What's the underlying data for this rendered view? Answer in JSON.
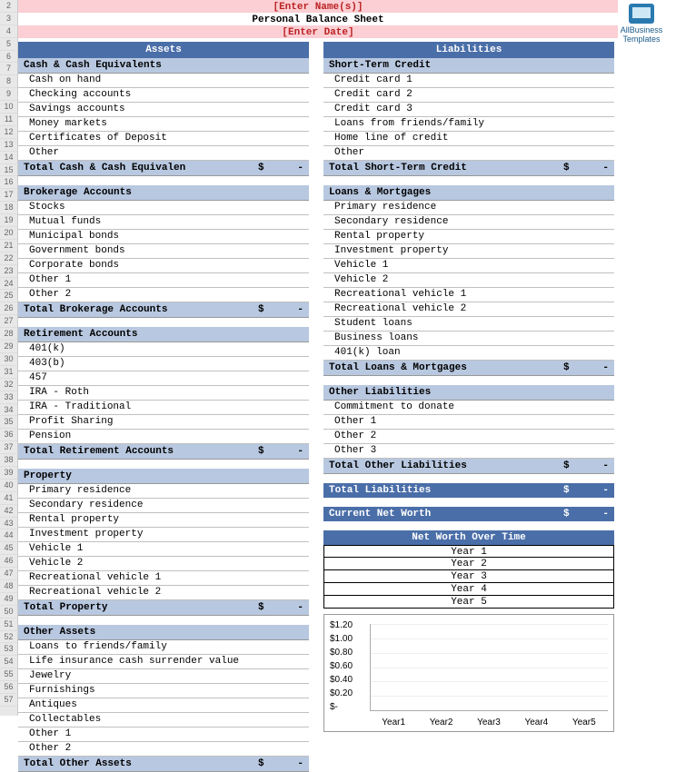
{
  "header": {
    "names_placeholder": "[Enter Name(s)]",
    "title": "Personal Balance Sheet",
    "date_placeholder": "[Enter Date]"
  },
  "logo": {
    "line1": "AllBusiness",
    "line2": "Templates"
  },
  "row_numbers": [
    2,
    3,
    4,
    5,
    6,
    7,
    8,
    9,
    10,
    11,
    12,
    13,
    14,
    15,
    16,
    17,
    18,
    19,
    20,
    21,
    22,
    23,
    24,
    25,
    26,
    27,
    28,
    29,
    30,
    31,
    32,
    33,
    34,
    35,
    36,
    37,
    38,
    39,
    40,
    41,
    42,
    43,
    44,
    45,
    46,
    47,
    48,
    49,
    50,
    51,
    52,
    53,
    54,
    55,
    56,
    57
  ],
  "assets": {
    "title": "Assets",
    "groups": [
      {
        "name": "Cash & Cash Equivalents",
        "items": [
          "Cash on hand",
          "Checking accounts",
          "Savings accounts",
          "Money markets",
          "Certificates of Deposit",
          "Other"
        ],
        "total": "Total Cash & Cash Equivalen"
      },
      {
        "name": "Brokerage Accounts",
        "items": [
          "Stocks",
          "Mutual funds",
          "Municipal bonds",
          "Government bonds",
          "Corporate bonds",
          "Other 1",
          "Other 2"
        ],
        "total": "Total Brokerage Accounts"
      },
      {
        "name": "Retirement Accounts",
        "items": [
          "401(k)",
          "403(b)",
          "457",
          "IRA - Roth",
          "IRA - Traditional",
          "Profit Sharing",
          "Pension"
        ],
        "total": "Total Retirement Accounts"
      },
      {
        "name": "Property",
        "items": [
          "Primary  residence",
          "Secondary residence",
          "Rental property",
          "Investment property",
          "Vehicle 1",
          "Vehicle 2",
          "Recreational vehicle 1",
          "Recreational vehicle 2"
        ],
        "total": "Total Property"
      },
      {
        "name": "Other Assets",
        "items": [
          "Loans to friends/family",
          "Life insurance cash surrender value",
          "Jewelry",
          "Furnishings",
          "Antiques",
          "Collectables",
          "Other 1",
          "Other 2"
        ],
        "total": "Total Other Assets"
      }
    ]
  },
  "liabilities": {
    "title": "Liabilities",
    "groups": [
      {
        "name": "Short-Term Credit",
        "items": [
          "Credit card 1",
          "Credit card 2",
          "Credit card 3",
          "Loans from friends/family",
          "Home line of credit",
          "Other"
        ],
        "total": "Total Short-Term Credit"
      },
      {
        "name": "Loans & Mortgages",
        "items": [
          "Primary  residence",
          "Secondary residence",
          "Rental property",
          "Investment property",
          "Vehicle 1",
          "Vehicle 2",
          "Recreational vehicle 1",
          "Recreational vehicle 2",
          "Student loans",
          "Business loans",
          "401(k) loan"
        ],
        "total": "Total Loans & Mortgages"
      },
      {
        "name": "Other Liabilities",
        "items": [
          "Commitment to donate",
          "Other 1",
          "Other 2",
          "Other 3"
        ],
        "total": "Total Other Liabilities"
      }
    ],
    "grand_total": "Total Liabilities"
  },
  "networth": {
    "current_label": "Current Net Worth",
    "overtime_title": "Net Worth Over Time",
    "years": [
      "Year 1",
      "Year 2",
      "Year 3",
      "Year 4",
      "Year 5"
    ]
  },
  "chart_data": {
    "type": "bar",
    "categories": [
      "Year1",
      "Year2",
      "Year3",
      "Year4",
      "Year5"
    ],
    "values": [
      0,
      0,
      0,
      0,
      0
    ],
    "title": "",
    "xlabel": "",
    "ylabel": "",
    "yticks": [
      "$1.20",
      "$1.00",
      "$0.80",
      "$0.60",
      "$0.40",
      "$0.20",
      "$-"
    ],
    "ylim": [
      0,
      1.2
    ]
  },
  "tokens": {
    "dollar": "$",
    "dash": "-"
  }
}
